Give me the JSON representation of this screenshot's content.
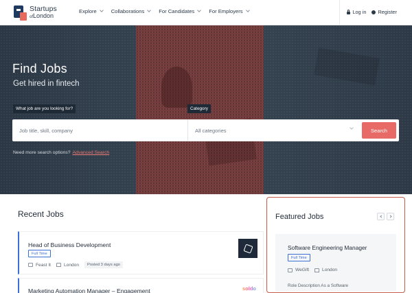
{
  "nav": {
    "logo_line1": "Startups",
    "logo_of": "of",
    "logo_line2": "London",
    "menu": [
      {
        "label": "Explore"
      },
      {
        "label": "Collaborations"
      },
      {
        "label": "For Candidates"
      },
      {
        "label": "For Employers"
      }
    ],
    "login": "Log in",
    "register": "Register"
  },
  "hero": {
    "title": "Find Jobs",
    "subtitle": "Get hired in fintech",
    "job_label": "What job are you looking for?",
    "category_label": "Category",
    "job_placeholder": "Job title, skill, company",
    "category_value": "All categories",
    "search_button": "Search",
    "more_options": "Need more search options?",
    "advanced_search": "Advanced Search"
  },
  "recent": {
    "title": "Recent Jobs",
    "jobs": [
      {
        "title": "Head of Business Development",
        "type": "Full Time",
        "company": "Feast It",
        "location": "London",
        "posted": "Posted 3 days ago"
      },
      {
        "title": "Marketing Automation Manager – Engagement",
        "company_logo_text": "soldo"
      }
    ]
  },
  "featured": {
    "title": "Featured Jobs",
    "job": {
      "title": "Software Engineering Manager",
      "type": "Full Time",
      "company": "WeGift",
      "location": "London",
      "description": "Role Description As a Software"
    }
  }
}
